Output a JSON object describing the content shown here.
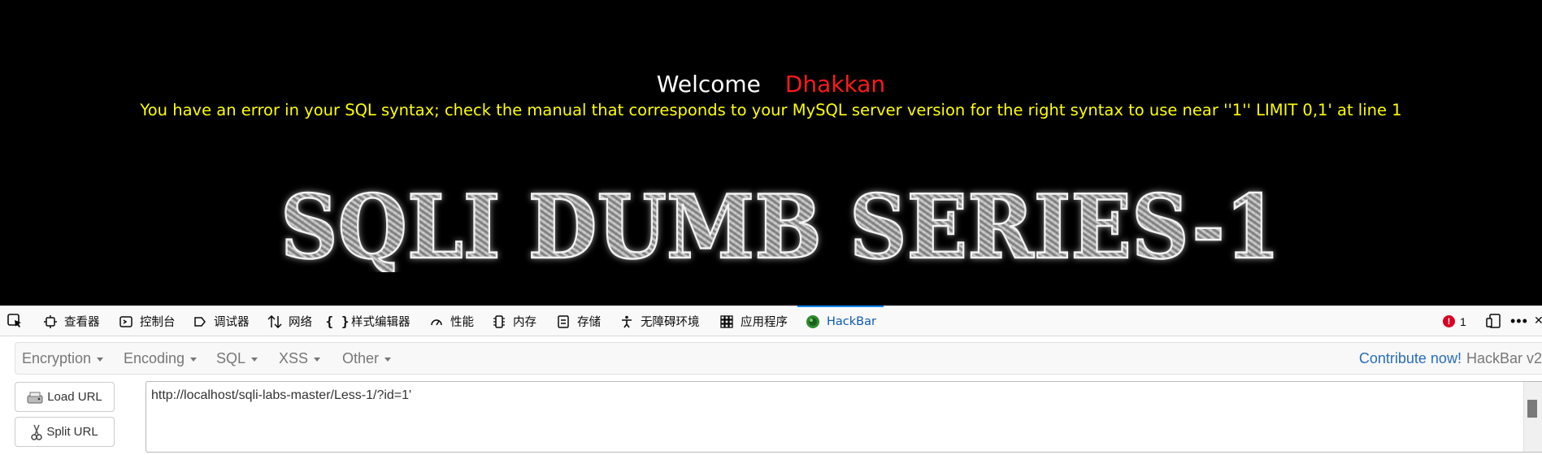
{
  "page": {
    "welcome": "Welcome",
    "username": "Dhakkan",
    "error_message": "You have an error in your SQL syntax; check the manual that corresponds to your MySQL server version for the right syntax to use near ''1'' LIMIT 0,1' at line 1",
    "banner_text": "SQLI DUMB SERIES-1"
  },
  "devtools": {
    "tabs": [
      {
        "label": "查看器",
        "icon": "inspector-icon"
      },
      {
        "label": "控制台",
        "icon": "console-icon"
      },
      {
        "label": "调试器",
        "icon": "debugger-icon"
      },
      {
        "label": "网络",
        "icon": "network-icon"
      },
      {
        "label": "样式编辑器",
        "icon": "style-editor-icon"
      },
      {
        "label": "性能",
        "icon": "performance-icon"
      },
      {
        "label": "内存",
        "icon": "memory-icon"
      },
      {
        "label": "存储",
        "icon": "storage-icon"
      },
      {
        "label": "无障碍环境",
        "icon": "accessibility-icon"
      },
      {
        "label": "应用程序",
        "icon": "application-icon"
      },
      {
        "label": "HackBar",
        "icon": "hackbar-icon",
        "active": true
      }
    ],
    "error_count": "1"
  },
  "hackbar": {
    "menus": [
      "Encryption",
      "Encoding",
      "SQL",
      "XSS",
      "Other"
    ],
    "contribute": "Contribute now!",
    "version": "HackBar v2",
    "load_url": "Load URL",
    "split_url": "Split URL",
    "url": "http://localhost/sqli-labs-master/Less-1/?id=1'"
  },
  "colors": {
    "error_text": "#ffff00",
    "username": "#ff1a1a",
    "active_tab": "#0a84ff",
    "link": "#2a6ebb"
  }
}
